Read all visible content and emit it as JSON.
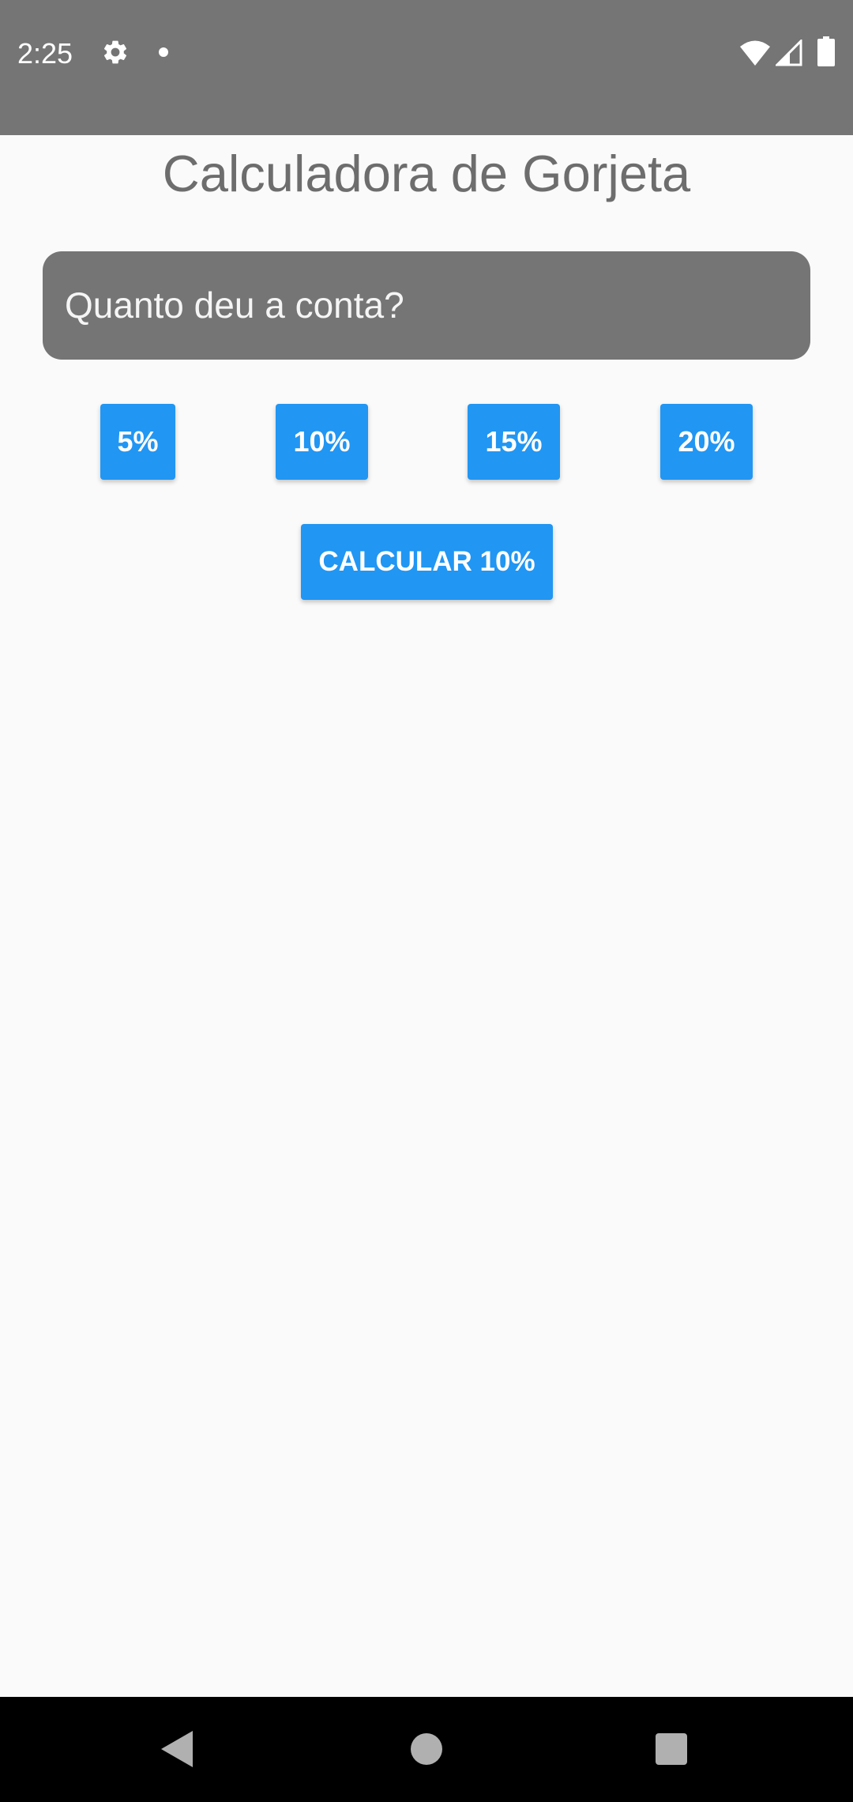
{
  "status_bar": {
    "time": "2:25",
    "icons": [
      "gear-icon",
      "notification-dot-icon",
      "wifi-icon",
      "signal-icon",
      "battery-icon"
    ]
  },
  "app": {
    "title": "Calculadora de Gorjeta"
  },
  "bill_input": {
    "placeholder": "Quanto deu a conta?",
    "value": ""
  },
  "tip_buttons": [
    {
      "label": "5%"
    },
    {
      "label": "10%"
    },
    {
      "label": "15%"
    },
    {
      "label": "20%"
    }
  ],
  "calculate_button": {
    "label": "CALCULAR 10%"
  },
  "nav_bar": {
    "icons": [
      "back-icon",
      "home-icon",
      "recents-icon"
    ]
  },
  "colors": {
    "status_bar": "#757575",
    "background": "#fafafa",
    "input_background": "#757575",
    "button_blue": "#2196f3",
    "title_text": "#6d6d6d",
    "nav_bar": "#000000"
  }
}
